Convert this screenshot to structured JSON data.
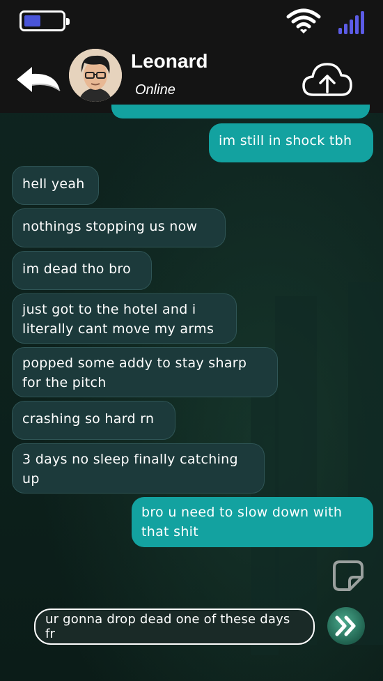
{
  "status_bar": {
    "battery_level": 0.45,
    "battery_color": "#4a55d9",
    "signal_color": "#5c5ce6",
    "wifi_icon": "wifi-icon",
    "signal_icon": "signal-bars-icon"
  },
  "header": {
    "back_icon": "back-arrow-icon",
    "contact_name": "Leonard",
    "contact_status": "Online",
    "upload_icon": "cloud-upload-icon"
  },
  "messages": [
    {
      "direction": "out",
      "text": "im still in shock tbh"
    },
    {
      "direction": "in",
      "text": "hell yeah"
    },
    {
      "direction": "in",
      "text": "nothings stopping us now"
    },
    {
      "direction": "in",
      "text": "im dead tho bro"
    },
    {
      "direction": "in",
      "text": "just got to the hotel and i\nliterally cant move my arms"
    },
    {
      "direction": "in",
      "text": "popped some addy to stay sharp\nfor the pitch"
    },
    {
      "direction": "in",
      "text": "crashing so hard rn"
    },
    {
      "direction": "in",
      "text": "3 days no sleep finally catching\nup"
    },
    {
      "direction": "out",
      "text": "bro u need to slow down with\nthat shit"
    }
  ],
  "composer": {
    "sticker_icon": "sticker-icon",
    "input_value": "ur gonna drop dead one of these days fr",
    "send_icon": "double-chevron-send-icon"
  },
  "colors": {
    "incoming_bubble": "#1c3a3b",
    "outgoing_bubble": "#13a2a0"
  }
}
